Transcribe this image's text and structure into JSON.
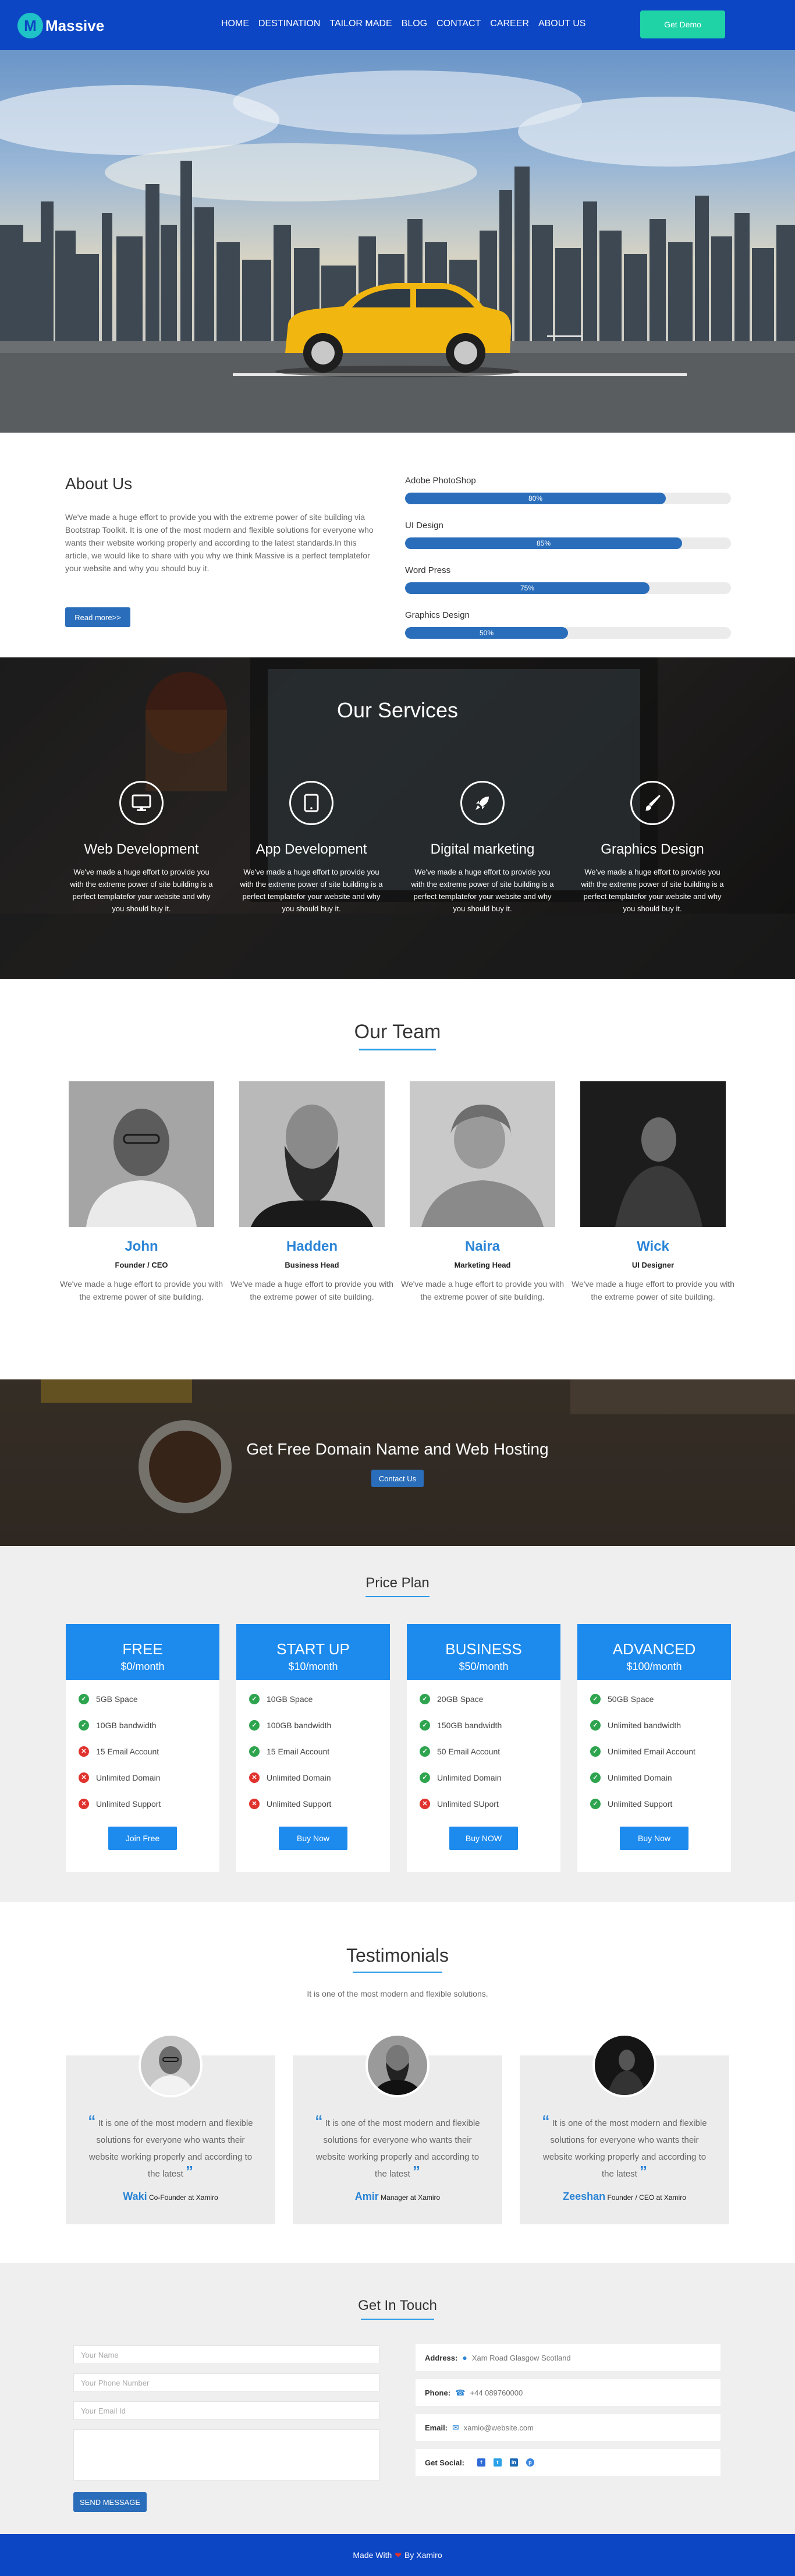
{
  "nav": {
    "logo_letter": "M",
    "logo_text": "Massive",
    "items": [
      "HOME",
      "DESTINATION",
      "TAILOR MADE",
      "BLOG",
      "CONTACT",
      "CAREER",
      "ABOUT US"
    ],
    "cta": "Get Demo"
  },
  "about": {
    "title": "About Us",
    "text": "We've made a huge effort to provide you with the extreme power of site building via Bootstrap Toolkit. It is one of the most modern and flexible solutions for everyone who wants their website working properly and according to the latest standards.In this article, we would like to share with you why we think Massive is a perfect templatefor your website and why you should buy it.",
    "button": "Read more>>",
    "skills": [
      {
        "label": "Adobe PhotoShop",
        "value": 80,
        "text": "80%"
      },
      {
        "label": "UI Design",
        "value": 85,
        "text": "85%"
      },
      {
        "label": "Word Press",
        "value": 75,
        "text": "75%"
      },
      {
        "label": "Graphics Design",
        "value": 50,
        "text": "50%"
      }
    ]
  },
  "services": {
    "title": "Our Services",
    "items": [
      {
        "icon": "monitor-icon",
        "title": "Web Development",
        "text": "We've made a huge effort to provide you with the extreme power of site building is a perfect templatefor your website and why you should buy it."
      },
      {
        "icon": "tablet-icon",
        "title": "App Development",
        "text": "We've made a huge effort to provide you with the extreme power of site building is a perfect templatefor your website and why you should buy it."
      },
      {
        "icon": "rocket-icon",
        "title": "Digital marketing",
        "text": "We've made a huge effort to provide you with the extreme power of site building is a perfect templatefor your website and why you should buy it."
      },
      {
        "icon": "brush-icon",
        "title": "Graphics Design",
        "text": "We've made a huge effort to provide you with the extreme power of site building is a perfect templatefor your website and why you should buy it."
      }
    ]
  },
  "team": {
    "title": "Our Team",
    "members": [
      {
        "name": "John",
        "role": "Founder / CEO",
        "text": "We've made a huge effort to provide you with the extreme power of site building."
      },
      {
        "name": "Hadden",
        "role": "Business Head",
        "text": "We've made a huge effort to provide you with the extreme power of site building."
      },
      {
        "name": "Naira",
        "role": "Marketing Head",
        "text": "We've made a huge effort to provide you with the extreme power of site building."
      },
      {
        "name": "Wick",
        "role": "UI Designer",
        "text": "We've made a huge effort to provide you with the extreme power of site building."
      }
    ]
  },
  "domain": {
    "title": "Get Free Domain Name and Web Hosting",
    "button": "Contact Us"
  },
  "pricing": {
    "title": "Price Plan",
    "plans": [
      {
        "name": "FREE",
        "price": "$0/month",
        "button": "Join Free",
        "features": [
          [
            "5GB Space",
            true
          ],
          [
            "10GB bandwidth",
            true
          ],
          [
            "15 Email Account",
            false
          ],
          [
            "Unlimited Domain",
            false
          ],
          [
            "Unlimited Support",
            false
          ]
        ]
      },
      {
        "name": "START UP",
        "price": "$10/month",
        "button": "Buy Now",
        "features": [
          [
            "10GB Space",
            true
          ],
          [
            "100GB bandwidth",
            true
          ],
          [
            "15 Email Account",
            true
          ],
          [
            "Unlimited Domain",
            false
          ],
          [
            "Unlimited Support",
            false
          ]
        ]
      },
      {
        "name": "BUSINESS",
        "price": "$50/month",
        "button": "Buy NOW",
        "features": [
          [
            "20GB Space",
            true
          ],
          [
            "150GB bandwidth",
            true
          ],
          [
            "50 Email Account",
            true
          ],
          [
            "Unlimited Domain",
            true
          ],
          [
            "Unlimited SUport",
            false
          ]
        ]
      },
      {
        "name": "ADVANCED",
        "price": "$100/month",
        "button": "Buy Now",
        "features": [
          [
            "50GB Space",
            true
          ],
          [
            "Unlimited bandwidth",
            true
          ],
          [
            "Unlimited Email Account",
            true
          ],
          [
            "Unlimited Domain",
            true
          ],
          [
            "Unlimited Support",
            true
          ]
        ]
      }
    ]
  },
  "testimonials": {
    "title": "Testimonials",
    "subtitle": "It is one of the most modern and flexible solutions.",
    "items": [
      {
        "quote": "It is one of the most modern and flexible solutions for everyone who wants their website working properly and according to the latest",
        "name": "Waki",
        "role": "Co-Founder at Xamiro"
      },
      {
        "quote": "It is one of the most modern and flexible solutions for everyone who wants their website working properly and according to the latest",
        "name": "Amir",
        "role": "Manager at Xamiro"
      },
      {
        "quote": "It is one of the most modern and flexible solutions for everyone who wants their website working properly and according to the latest",
        "name": "Zeeshan",
        "role": "Founder / CEO at Xamiro"
      }
    ]
  },
  "contact": {
    "title": "Get In Touch",
    "placeholders": {
      "name": "Your Name",
      "phone": "Your Phone Number",
      "email": "Your Email Id"
    },
    "button": "SEND MESSAGE",
    "address_label": "Address:",
    "address": "Xam Road Glasgow Scotland",
    "phone_label": "Phone:",
    "phone": "+44 089760000",
    "email_label": "Email:",
    "email": "xamio@website.com",
    "social_label": "Get Social:"
  },
  "footer": {
    "made_with": "Made With",
    "by": "By Xamiro"
  },
  "colors": {
    "brand": "#0d46c4",
    "accent": "#1d8bee",
    "cta": "#1fd3a6"
  }
}
